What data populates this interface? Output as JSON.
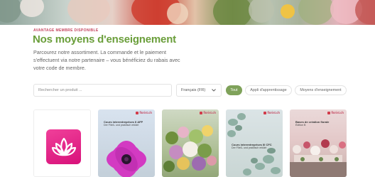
{
  "banner": {
    "description": "decorative floral banner"
  },
  "eyebrow": "AVANTAGE MEMBRE DISPONIBLE",
  "title": "Nos moyens d'enseignement",
  "intro": "Parcourez notre assortiment. La commande et le paiement s'effectuent via notre partenaire – vous bénéficiez du rabais avec votre code de membre.",
  "search": {
    "placeholder": "Rechercher un produit ..."
  },
  "language": {
    "selected": "Français (FR)"
  },
  "filters": [
    {
      "label": "Tout",
      "active": true
    },
    {
      "label": "Appli d'apprentissage",
      "active": false
    },
    {
      "label": "Moyens d'enseignement",
      "active": false
    }
  ],
  "cards": [
    {
      "type": "app",
      "icon": "lotus-app-icon"
    },
    {
      "brand": "florist.ch",
      "caption_title": "Cours interentreprises II AFP",
      "caption_sub": "Der Fließ- und praktisch erklärt"
    },
    {
      "brand": "florist.ch",
      "caption_title": "",
      "caption_sub": ""
    },
    {
      "brand": "florist.ch",
      "caption_title": "Cours interentreprises III CFC",
      "caption_sub": "Der Fließ- und praktisch erklärt"
    },
    {
      "brand": "florist.ch",
      "caption_title": "Bases de création florale",
      "caption_sub": "Édition B"
    }
  ],
  "colors": {
    "accent_green": "#6a9e3a",
    "eyebrow_pink": "#c4465f",
    "active_pill": "#7fa25a",
    "app_pink": "#e5258b"
  }
}
